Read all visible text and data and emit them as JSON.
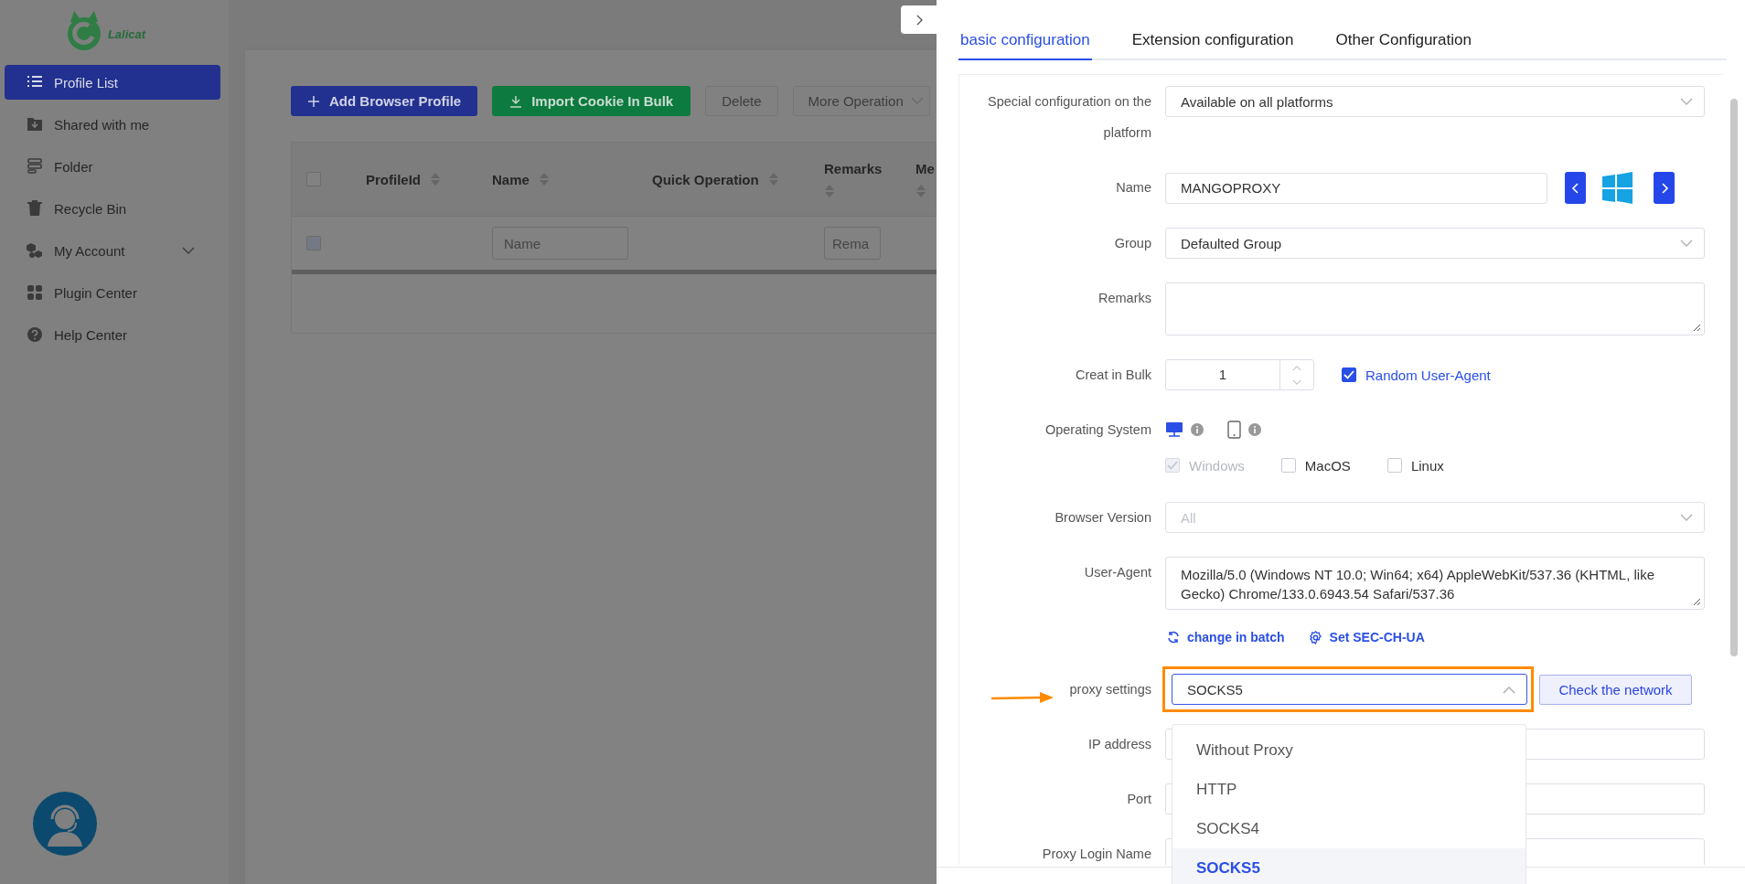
{
  "sidebar": {
    "logo": "Lalicat",
    "items": [
      {
        "label": "Profile List",
        "selected": true
      },
      {
        "label": "Shared with me",
        "selected": false
      },
      {
        "label": "Folder",
        "selected": false
      },
      {
        "label": "Recycle Bin",
        "selected": false
      },
      {
        "label": "My Account",
        "selected": false,
        "expandable": true
      },
      {
        "label": "Plugin Center",
        "selected": false
      },
      {
        "label": "Help Center",
        "selected": false
      }
    ]
  },
  "toolbar": {
    "buttons": [
      {
        "label": "Add Browser Profile",
        "kind": "primary"
      },
      {
        "label": "Import Cookie In Bulk",
        "kind": "import"
      },
      {
        "label": "Delete",
        "kind": "disabled"
      },
      {
        "label": "More Operation",
        "kind": "dropdown"
      }
    ]
  },
  "table": {
    "columns": [
      {
        "kind": "checkbox",
        "checked": false
      },
      {
        "label": "ProfileId",
        "sortable": true
      },
      {
        "label": "Name",
        "sortable": true
      },
      {
        "label": "Quick Operation",
        "sortable": true
      },
      {
        "label": "Remarks",
        "sortable": true
      },
      {
        "label": "Me",
        "sortable": true
      }
    ],
    "filters": [
      {
        "kind": "checkbox",
        "disabled": true
      },
      {
        "kind": "empty"
      },
      {
        "kind": "input",
        "placeholder": "Name"
      },
      {
        "kind": "empty"
      },
      {
        "kind": "input",
        "placeholder": "Rema"
      },
      {
        "kind": "empty"
      }
    ]
  },
  "drawer": {
    "tabs": [
      {
        "label": "basic configuration",
        "selected": true
      },
      {
        "label": "Extension configuration",
        "selected": false
      },
      {
        "label": "Other Configuration",
        "selected": false
      }
    ],
    "fields": [
      {
        "kind": "select",
        "label": "Special configuration on the platform",
        "value": "Available on all platforms"
      },
      {
        "kind": "name",
        "label": "Name",
        "value": "MANGOPROXY"
      },
      {
        "kind": "select",
        "label": "Group",
        "value": "Defaulted Group"
      },
      {
        "kind": "textarea",
        "label": "Remarks"
      },
      {
        "kind": "bulk",
        "label": "Creat in Bulk",
        "value": "1",
        "checkbox": {
          "label": "Random User-Agent",
          "checked": true
        }
      },
      {
        "kind": "os",
        "label": "Operating System",
        "devices": [
          {
            "kind": "desktop",
            "selected": true
          },
          {
            "kind": "mobile",
            "selected": false
          }
        ],
        "options": [
          {
            "label": "Windows",
            "checked": true,
            "disabled": true
          },
          {
            "label": "MacOS",
            "checked": false,
            "disabled": false
          },
          {
            "label": "Linux",
            "checked": false,
            "disabled": false
          }
        ]
      },
      {
        "kind": "select",
        "label": "Browser Version",
        "placeholder": "All"
      },
      {
        "kind": "textarea",
        "label": "User-Agent",
        "value": "Mozilla/5.0 (Windows NT 10.0; Win64; x64) AppleWebKit/537.36 (KHTML, like Gecko) Chrome/133.0.6943.54 Safari/537.36"
      },
      {
        "kind": "links",
        "links": [
          {
            "label": "change in batch",
            "kind": "refresh"
          },
          {
            "label": "Set SEC-CH-UA",
            "kind": "settings"
          }
        ]
      },
      {
        "kind": "proxy",
        "label": "proxy settings",
        "value": "SOCKS5",
        "expanded": true,
        "highlighted": true,
        "action": "Check the network",
        "options": [
          {
            "label": "Without Proxy",
            "selected": false
          },
          {
            "label": "HTTP",
            "selected": false
          },
          {
            "label": "SOCKS4",
            "selected": false
          },
          {
            "label": "SOCKS5",
            "selected": true
          }
        ]
      },
      {
        "kind": "input",
        "label": "IP address"
      },
      {
        "kind": "input",
        "label": "Port"
      },
      {
        "kind": "input",
        "label": "Proxy Login Name"
      }
    ]
  }
}
